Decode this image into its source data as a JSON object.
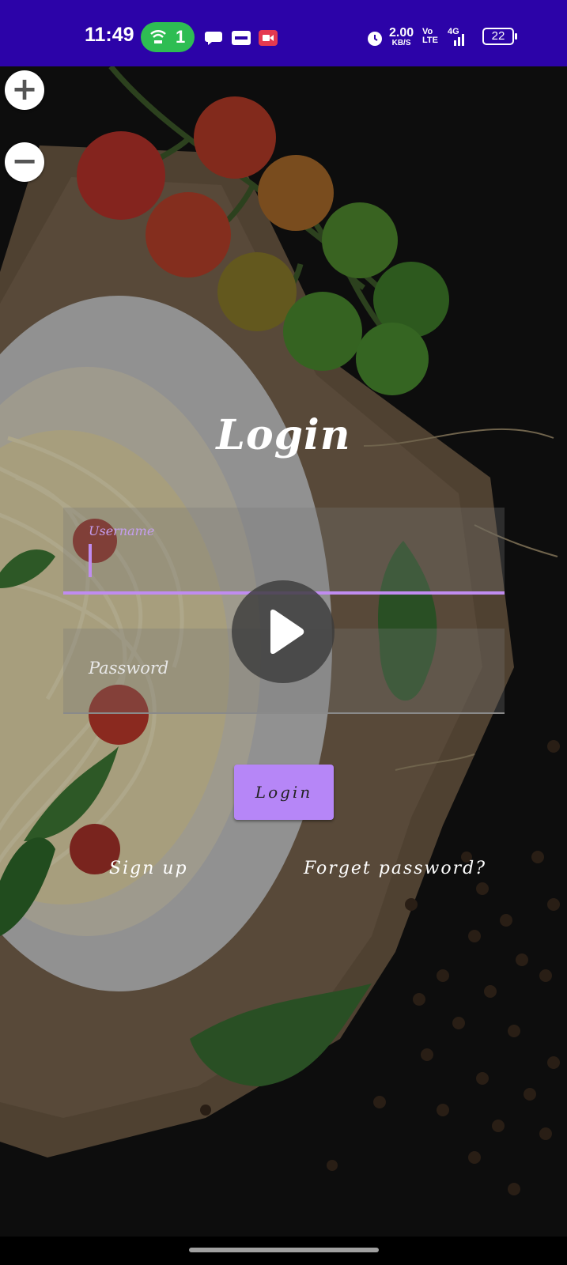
{
  "status_bar": {
    "time": "11:49",
    "call_count": "1",
    "net_speed_value": "2.00",
    "net_speed_unit": "KB/S",
    "volte_top": "Vo",
    "volte_bottom": "LTE",
    "signal_type": "4G",
    "battery": "22"
  },
  "map_controls": {
    "zoom_in": "+",
    "zoom_out": "−"
  },
  "login": {
    "title": "Login",
    "username_label": "Username",
    "password_label": "Password",
    "login_button": "Login",
    "signup_link": "Sign up",
    "forgot_link": "Forget password?"
  },
  "colors": {
    "status_bar": "#2c03a8",
    "accent": "#b686f7",
    "call_pill": "#2ebd53"
  }
}
